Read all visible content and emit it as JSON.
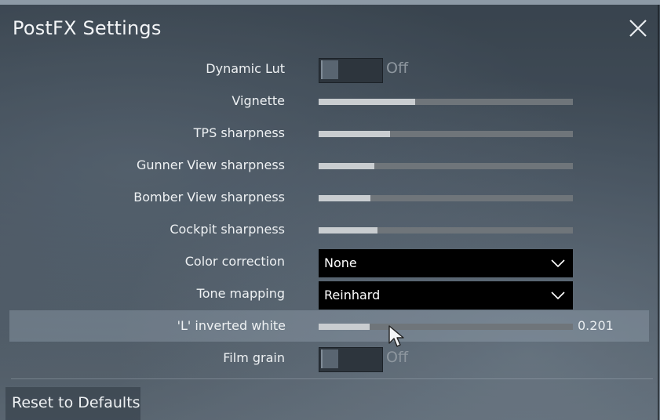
{
  "window": {
    "title": "PostFX Settings"
  },
  "settings": {
    "dynamic_lut": {
      "label": "Dynamic Lut",
      "state": "Off"
    },
    "vignette": {
      "label": "Vignette",
      "level": 0.38
    },
    "tps_sharpness": {
      "label": "TPS sharpness",
      "level": 0.28
    },
    "gunner_view_sharpness": {
      "label": "Gunner View sharpness",
      "level": 0.22
    },
    "bomber_view_sharpness": {
      "label": "Bomber View sharpness",
      "level": 0.205
    },
    "cockpit_sharpness": {
      "label": "Cockpit sharpness",
      "level": 0.23
    },
    "color_correction": {
      "label": "Color correction",
      "value": "None"
    },
    "tone_mapping": {
      "label": "Tone mapping",
      "value": "Reinhard"
    },
    "l_inverted_white": {
      "label": "'L' inverted white",
      "value": "0.201",
      "level": 0.201
    },
    "film_grain": {
      "label": "Film grain",
      "state": "Off"
    }
  },
  "footer": {
    "reset_label": "Reset to Defaults"
  },
  "icons": {
    "close": "close-icon",
    "dropdown": "chevron-down-icon",
    "cursor": "mouse-pointer-icon"
  },
  "colors": {
    "dropdown_bg": "#000000",
    "slider_fill": "#c9cdd0",
    "slider_track": "#6f757a",
    "highlight_row": "#8a97a4"
  }
}
